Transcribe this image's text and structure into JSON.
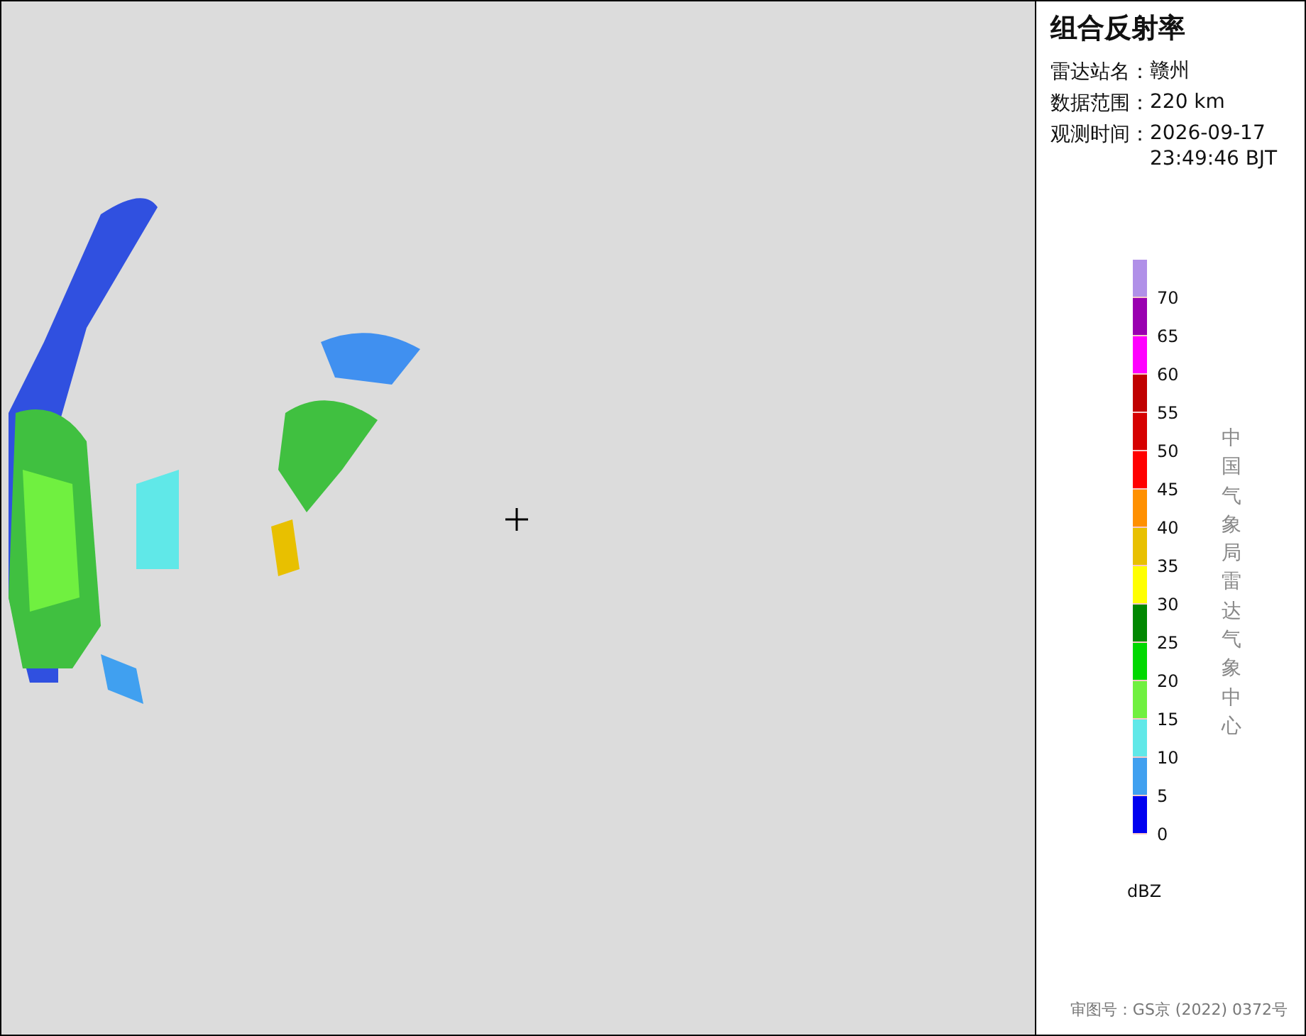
{
  "panel": {
    "title": "组合反射率",
    "info": [
      {
        "label": "雷达站名：",
        "value": "赣州"
      },
      {
        "label": "数据范围：",
        "value": "220 km"
      },
      {
        "label": "观测时间：",
        "value": "2026-09-17\n23:49:46 BJT"
      }
    ]
  },
  "legend": {
    "bins": [
      {
        "color": "#b090e8"
      },
      {
        "color": "#9900b0"
      },
      {
        "color": "#ff00ff"
      },
      {
        "color": "#c00000"
      },
      {
        "color": "#d60000"
      },
      {
        "color": "#ff0000"
      },
      {
        "color": "#ff9000"
      },
      {
        "color": "#e8c000"
      },
      {
        "color": "#ffff00"
      },
      {
        "color": "#008800"
      },
      {
        "color": "#00d800"
      },
      {
        "color": "#70f040"
      },
      {
        "color": "#60e8e8"
      },
      {
        "color": "#40a0f0"
      },
      {
        "color": "#0000f0"
      }
    ],
    "ticks": [
      "70",
      "65",
      "60",
      "55",
      "50",
      "45",
      "40",
      "35",
      "30",
      "25",
      "20",
      "15",
      "10",
      "5",
      "0"
    ],
    "unit": "dBZ",
    "credit": "中国气象局雷达气象中心"
  },
  "footer": "审图号：GS京 (2022) 0372号"
}
